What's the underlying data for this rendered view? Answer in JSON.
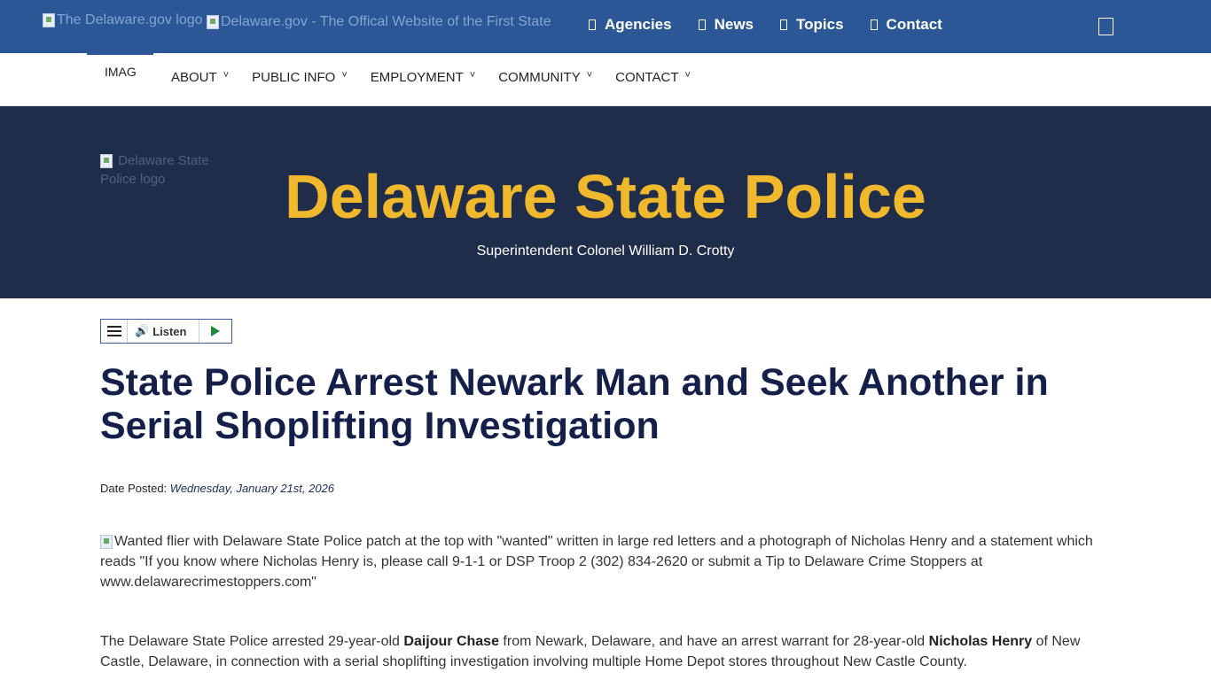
{
  "statebar": {
    "logo_alt": "The Delaware.gov logo",
    "site_alt": "Delaware.gov - The Offical Website of the First State",
    "nav": [
      "Agencies",
      "News",
      "Topics",
      "Contact"
    ]
  },
  "agency_nav": {
    "home_alt": "IMAGE",
    "items": [
      "ABOUT",
      "PUBLIC INFO",
      "EMPLOYMENT",
      "COMMUNITY",
      "CONTACT"
    ]
  },
  "hero": {
    "seal_alt": "Delaware State Police logo",
    "title": "Delaware State Police",
    "subtitle": "Superintendent Colonel William D. Crotty"
  },
  "listen": {
    "label": "Listen"
  },
  "article": {
    "headline": "State Police Arrest Newark Man and Seek Another in Serial Shoplifting Investigation",
    "date_label": "Date Posted:",
    "date_value": "Wednesday, January 21st, 2026",
    "flier_alt": "Wanted flier with Delaware State Police patch at the top with \"wanted\" written in large red letters and a photograph of Nicholas Henry and a statement which reads \"If you know where Nicholas Henry is, please call 9-1-1 or DSP Troop 2 (302) 834-2620 or submit a Tip to Delaware Crime Stoppers at www.delawarecrimestoppers.com\"",
    "p1_a": "The Delaware State Police arrested 29-year-old ",
    "p1_name1": "Daijour Chase",
    "p1_b": " from Newark, Delaware, and have an arrest warrant for 28-year-old ",
    "p1_name2": "Nicholas Henry",
    "p1_c": " of New Castle, Delaware, in connection with a serial shoplifting investigation involving multiple Home Depot stores throughout New Castle County."
  },
  "colors": {
    "statebar_bg": "#2b5797",
    "hero_bg": "#1f2d4a",
    "hero_title": "#f0b92d",
    "headline": "#15204a"
  }
}
